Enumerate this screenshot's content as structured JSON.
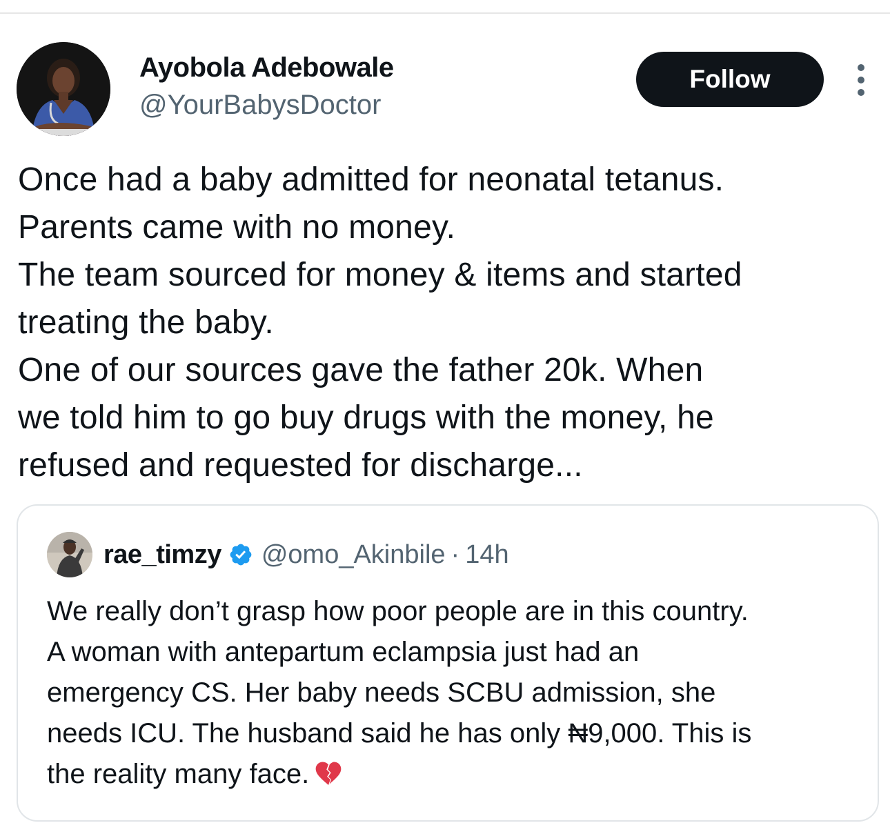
{
  "tweet": {
    "author": {
      "name": "Ayobola Adebowale",
      "handle": "@YourBabysDoctor"
    },
    "follow_label": "Follow",
    "more_icon": "more-vertical-icon",
    "text_lines": [
      "Once had a baby admitted for neonatal tetanus.",
      "Parents came with no money.",
      "The team sourced for money & items and started",
      "treating the baby.",
      "One of our sources gave the father 20k. When",
      "we told him to go buy drugs with the money, he",
      "refused and  requested for discharge..."
    ]
  },
  "quoted_tweet": {
    "author": {
      "name": "rae_timzy",
      "handle": "@omo_Akinbile",
      "verified": true
    },
    "separator": "·",
    "time": "14h",
    "text_lines": [
      "We really don’t grasp how poor people are in this country.",
      "A woman with antepartum eclampsia just had an",
      "emergency CS. Her baby needs SCBU admission, she",
      "needs ICU. The husband said he has only ₦9,000. This is",
      "the reality many face."
    ],
    "emoji": "broken-heart-icon"
  },
  "colors": {
    "text": "#0f1419",
    "secondary_text": "#536471",
    "follow_bg": "#0f1419",
    "verified": "#1d9bf0",
    "border": "#e1e5e8",
    "broken_heart": "#e0384a"
  }
}
